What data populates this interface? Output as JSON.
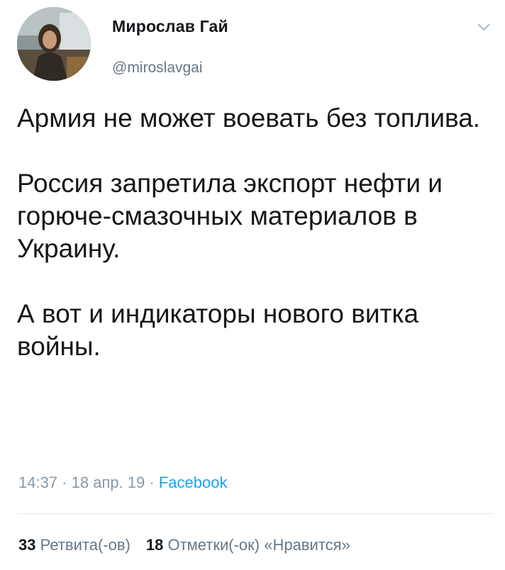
{
  "author": {
    "display_name": "Мирослав Гай",
    "handle": "@miroslavgai",
    "avatar_icon": "profile-photo"
  },
  "menu": {
    "icon": "chevron-down-icon"
  },
  "tweet": {
    "paragraphs": [
      "Армия не может воевать без топлива.",
      "Россия запретила экспорт нефти и горюче-смазочных материалов в Украину.",
      "А вот и индикаторы нового витка войны."
    ],
    "time": "14:37",
    "date": "18 апр. 19",
    "separator": " · ",
    "source": "Facebook"
  },
  "stats": {
    "retweets_count": "33",
    "retweets_label": "Ретвита(-ов)",
    "likes_count": "18",
    "likes_label": "Отметки(-ок) «Нравится»"
  },
  "colors": {
    "text": "#14171a",
    "secondary": "#657786",
    "meta": "#8899a6",
    "link": "#1da1f2",
    "divider": "#e1e8ed"
  }
}
